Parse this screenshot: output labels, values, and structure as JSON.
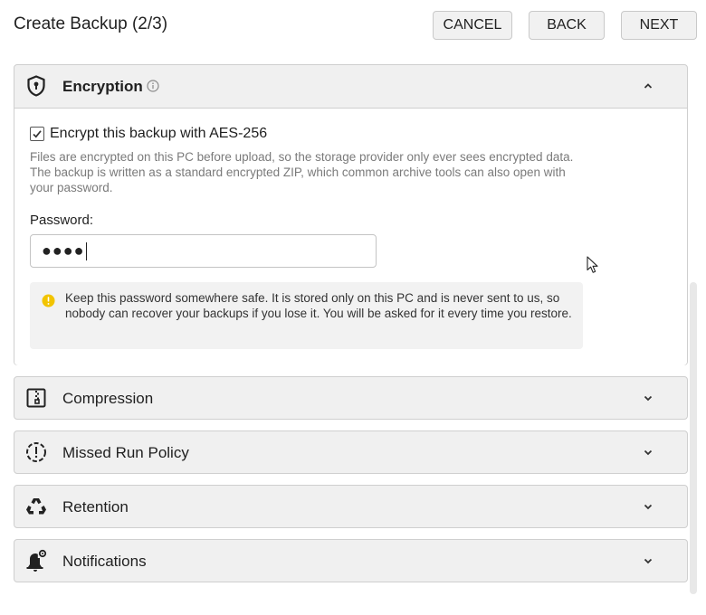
{
  "header": {
    "title": "Create Backup (2/3)",
    "cancel_label": "CANCEL",
    "back_label": "BACK",
    "next_label": "NEXT"
  },
  "encryption": {
    "title": "Encryption",
    "info_icon": "info-icon",
    "checkbox_label": "Encrypt this backup with AES-256",
    "checkbox_checked": true,
    "description": "Files are encrypted on this PC before upload, so the storage provider only ever sees encrypted data. The backup is written as a standard encrypted ZIP, which common archive tools can also open with your password.",
    "password_label": "Password:",
    "password_value": "●●●●",
    "warning_text": "Keep this password somewhere safe. It is stored only on this PC and is never sent to us, so nobody can recover your backups if you lose it. You will be asked for it every time you restore.",
    "warning_color": "#f2c400"
  },
  "sections": [
    {
      "label": "Compression",
      "icon": "zip-file-icon"
    },
    {
      "label": "Missed Run Policy",
      "icon": "alert-circle-icon"
    },
    {
      "label": "Retention",
      "icon": "recycle-icon"
    },
    {
      "label": "Notifications",
      "icon": "bell-gear-icon"
    }
  ]
}
